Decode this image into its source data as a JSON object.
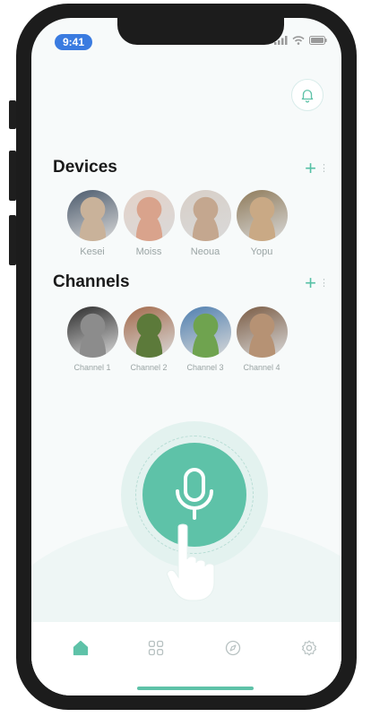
{
  "status_bar": {
    "time": "9:41"
  },
  "devices": {
    "title": "Devices",
    "add_symbol": "+",
    "items": [
      {
        "label": "Kesei",
        "colors": [
          "#4b5a6c",
          "#c9b29a"
        ]
      },
      {
        "label": "Moiss",
        "colors": [
          "#e4d2c8",
          "#d9a38c"
        ]
      },
      {
        "label": "Neoua",
        "colors": [
          "#d8cfc7",
          "#c4a78f"
        ]
      },
      {
        "label": "Yopu",
        "colors": [
          "#8f7b5a",
          "#c9a985"
        ]
      }
    ]
  },
  "channels": {
    "title": "Channels",
    "add_symbol": "+",
    "items": [
      {
        "label": "Channel 1",
        "colors": [
          "#2b2b2b",
          "#8c8c8c"
        ]
      },
      {
        "label": "Channel 2",
        "colors": [
          "#a36a4b",
          "#5c7a3a"
        ]
      },
      {
        "label": "Channel 3",
        "colors": [
          "#4f7fb0",
          "#6fa34f"
        ]
      },
      {
        "label": "Channel 4",
        "colors": [
          "#7a5b43",
          "#b69274"
        ]
      }
    ]
  },
  "tabbar": {
    "tabs": [
      {
        "name": "home",
        "icon": "home-icon",
        "active": true
      },
      {
        "name": "apps",
        "icon": "grid-icon",
        "active": false
      },
      {
        "name": "explore",
        "icon": "compass-icon",
        "active": false
      },
      {
        "name": "settings",
        "icon": "gear-icon",
        "active": false
      }
    ]
  },
  "theme": {
    "accent": "#5ec2a8",
    "text": "#1a1a1a",
    "muted": "#9aa4a4"
  }
}
